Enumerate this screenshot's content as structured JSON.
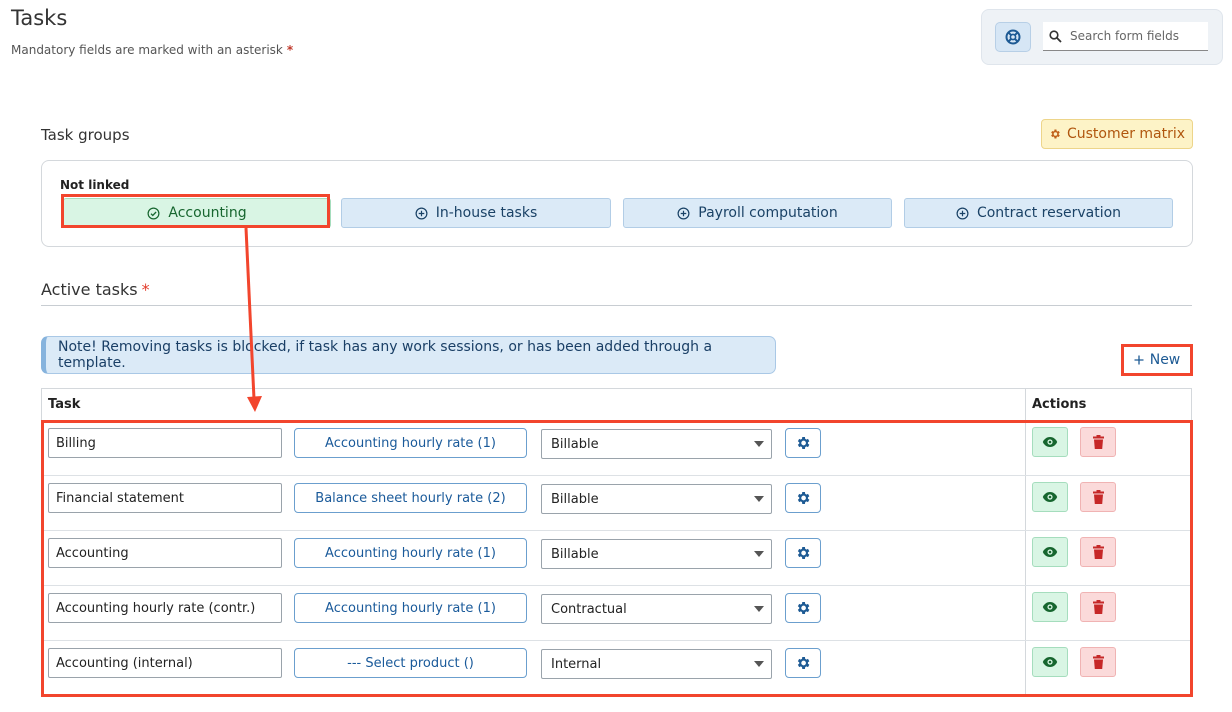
{
  "header": {
    "title": "Tasks",
    "subtitle": "Mandatory fields are marked with an asterisk",
    "required_marker": "*"
  },
  "search": {
    "placeholder": "Search form fields",
    "help_icon": "lifebuoy-icon",
    "search_icon": "search-icon"
  },
  "task_groups": {
    "label": "Task groups",
    "customer_matrix_label": "Customer matrix",
    "not_linked_label": "Not linked",
    "groups": [
      {
        "label": "Accounting",
        "state": "linked",
        "icon": "check-circle-icon"
      },
      {
        "label": "In-house tasks",
        "state": "available",
        "icon": "plus-circle-icon"
      },
      {
        "label": "Payroll computation",
        "state": "available",
        "icon": "plus-circle-icon"
      },
      {
        "label": "Contract reservation",
        "state": "available",
        "icon": "plus-circle-icon"
      }
    ]
  },
  "active_tasks": {
    "title": "Active tasks",
    "required_marker": "*",
    "note": "Note! Removing tasks is blocked, if task has any work sessions, or has been added through a template.",
    "new_label": "New",
    "columns": {
      "task": "Task",
      "actions": "Actions"
    },
    "rows": [
      {
        "task": "Billing",
        "product": "Accounting hourly rate (1)",
        "type": "Billable"
      },
      {
        "task": "Financial statement",
        "product": "Balance sheet hourly rate (2)",
        "type": "Billable"
      },
      {
        "task": "Accounting",
        "product": "Accounting hourly rate (1)",
        "type": "Billable"
      },
      {
        "task": "Accounting hourly rate (contr.)",
        "product": "Accounting hourly rate (1)",
        "type": "Contractual"
      },
      {
        "task": "Accounting (internal)",
        "product": "--- Select product ()",
        "type": "Internal"
      }
    ]
  },
  "colors": {
    "accent": "#1d5a94",
    "highlight": "#f2452d",
    "linked_group": "#d9f5e4",
    "danger": "#c62828"
  }
}
